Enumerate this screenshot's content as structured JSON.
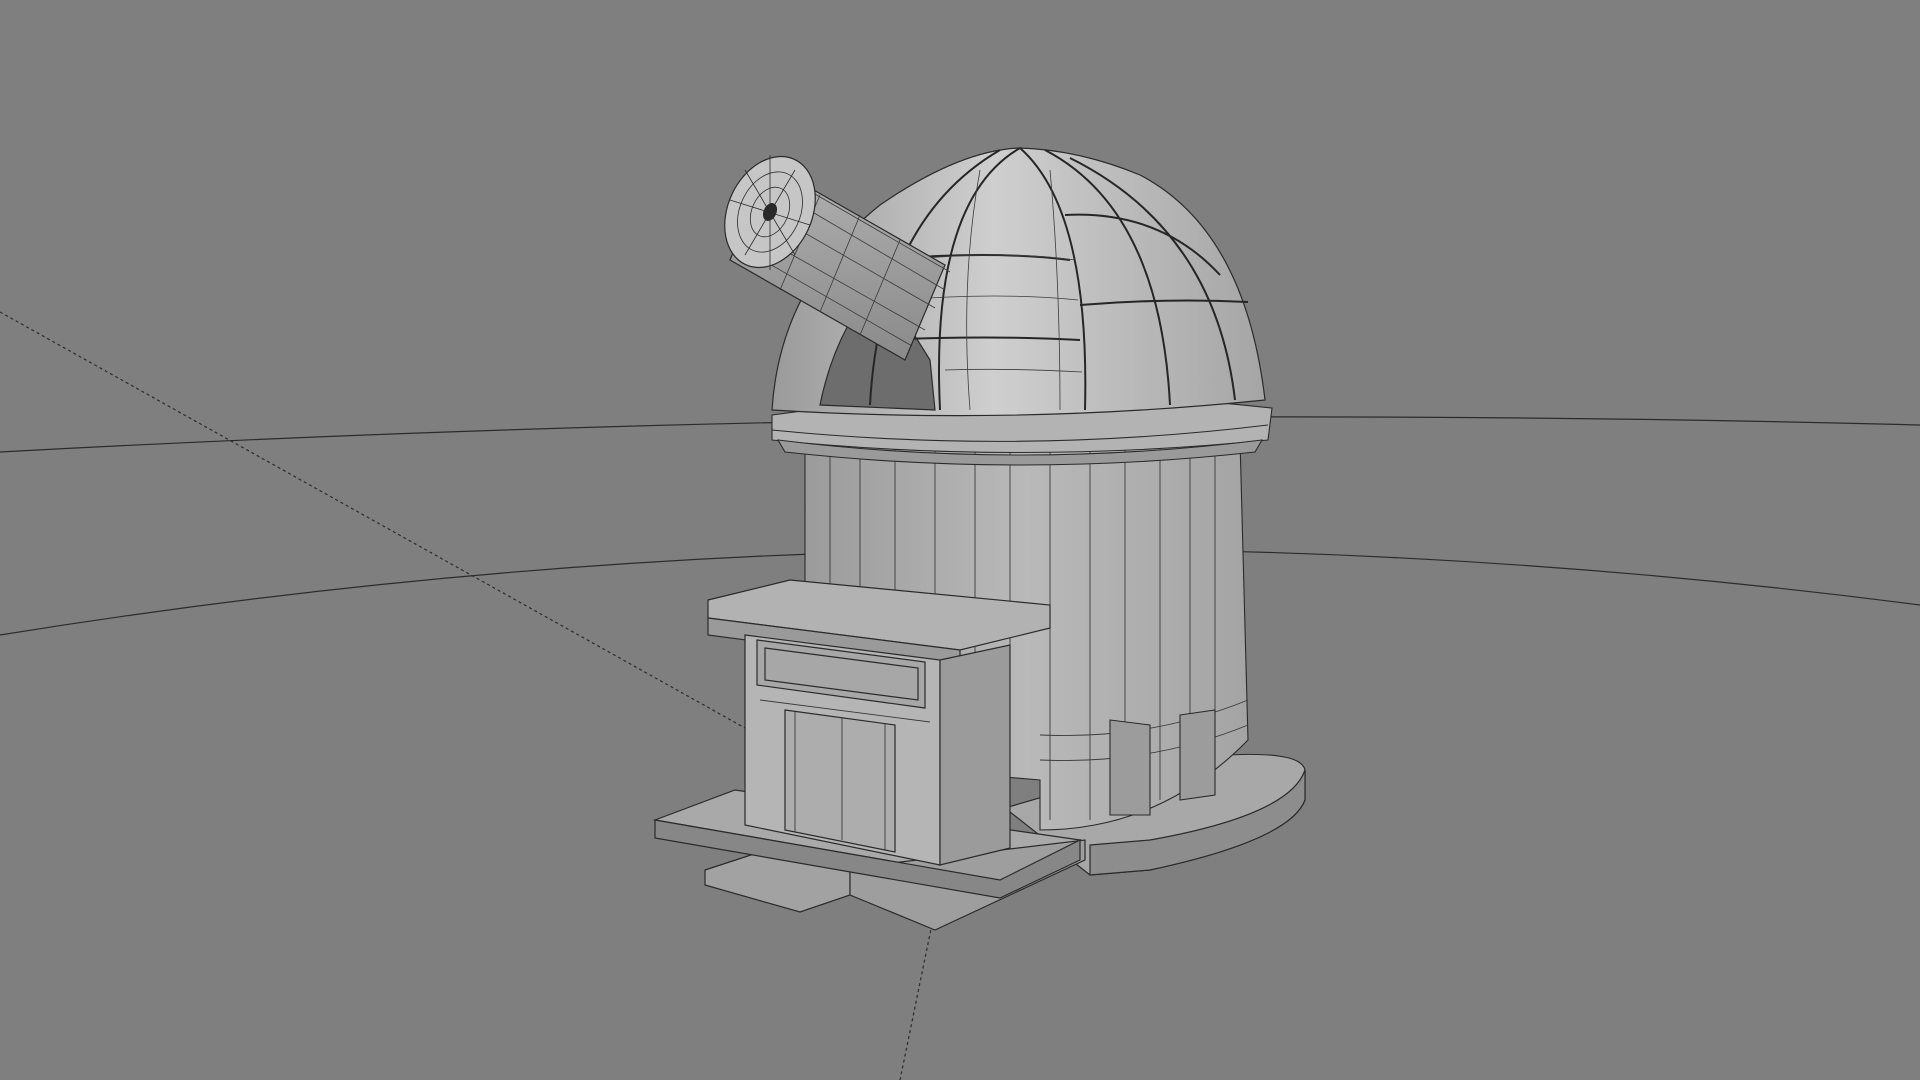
{
  "viewport": {
    "kind": "3d-viewport",
    "background": "#7f7f7f",
    "shading": "solid-wireframe",
    "colors": {
      "surface_light": "#bdbdbd",
      "surface_mid": "#a3a3a3",
      "surface_dark": "#8f8f8f",
      "wire": "#2a2a2a",
      "guide": "#2b2b2b"
    }
  },
  "scene": {
    "object": "observatory",
    "parts": [
      "telescope-tube",
      "dome",
      "dome-ribs",
      "dome-ring",
      "tower",
      "entrance-annex",
      "entrance-door",
      "base-platform",
      "steps"
    ]
  }
}
